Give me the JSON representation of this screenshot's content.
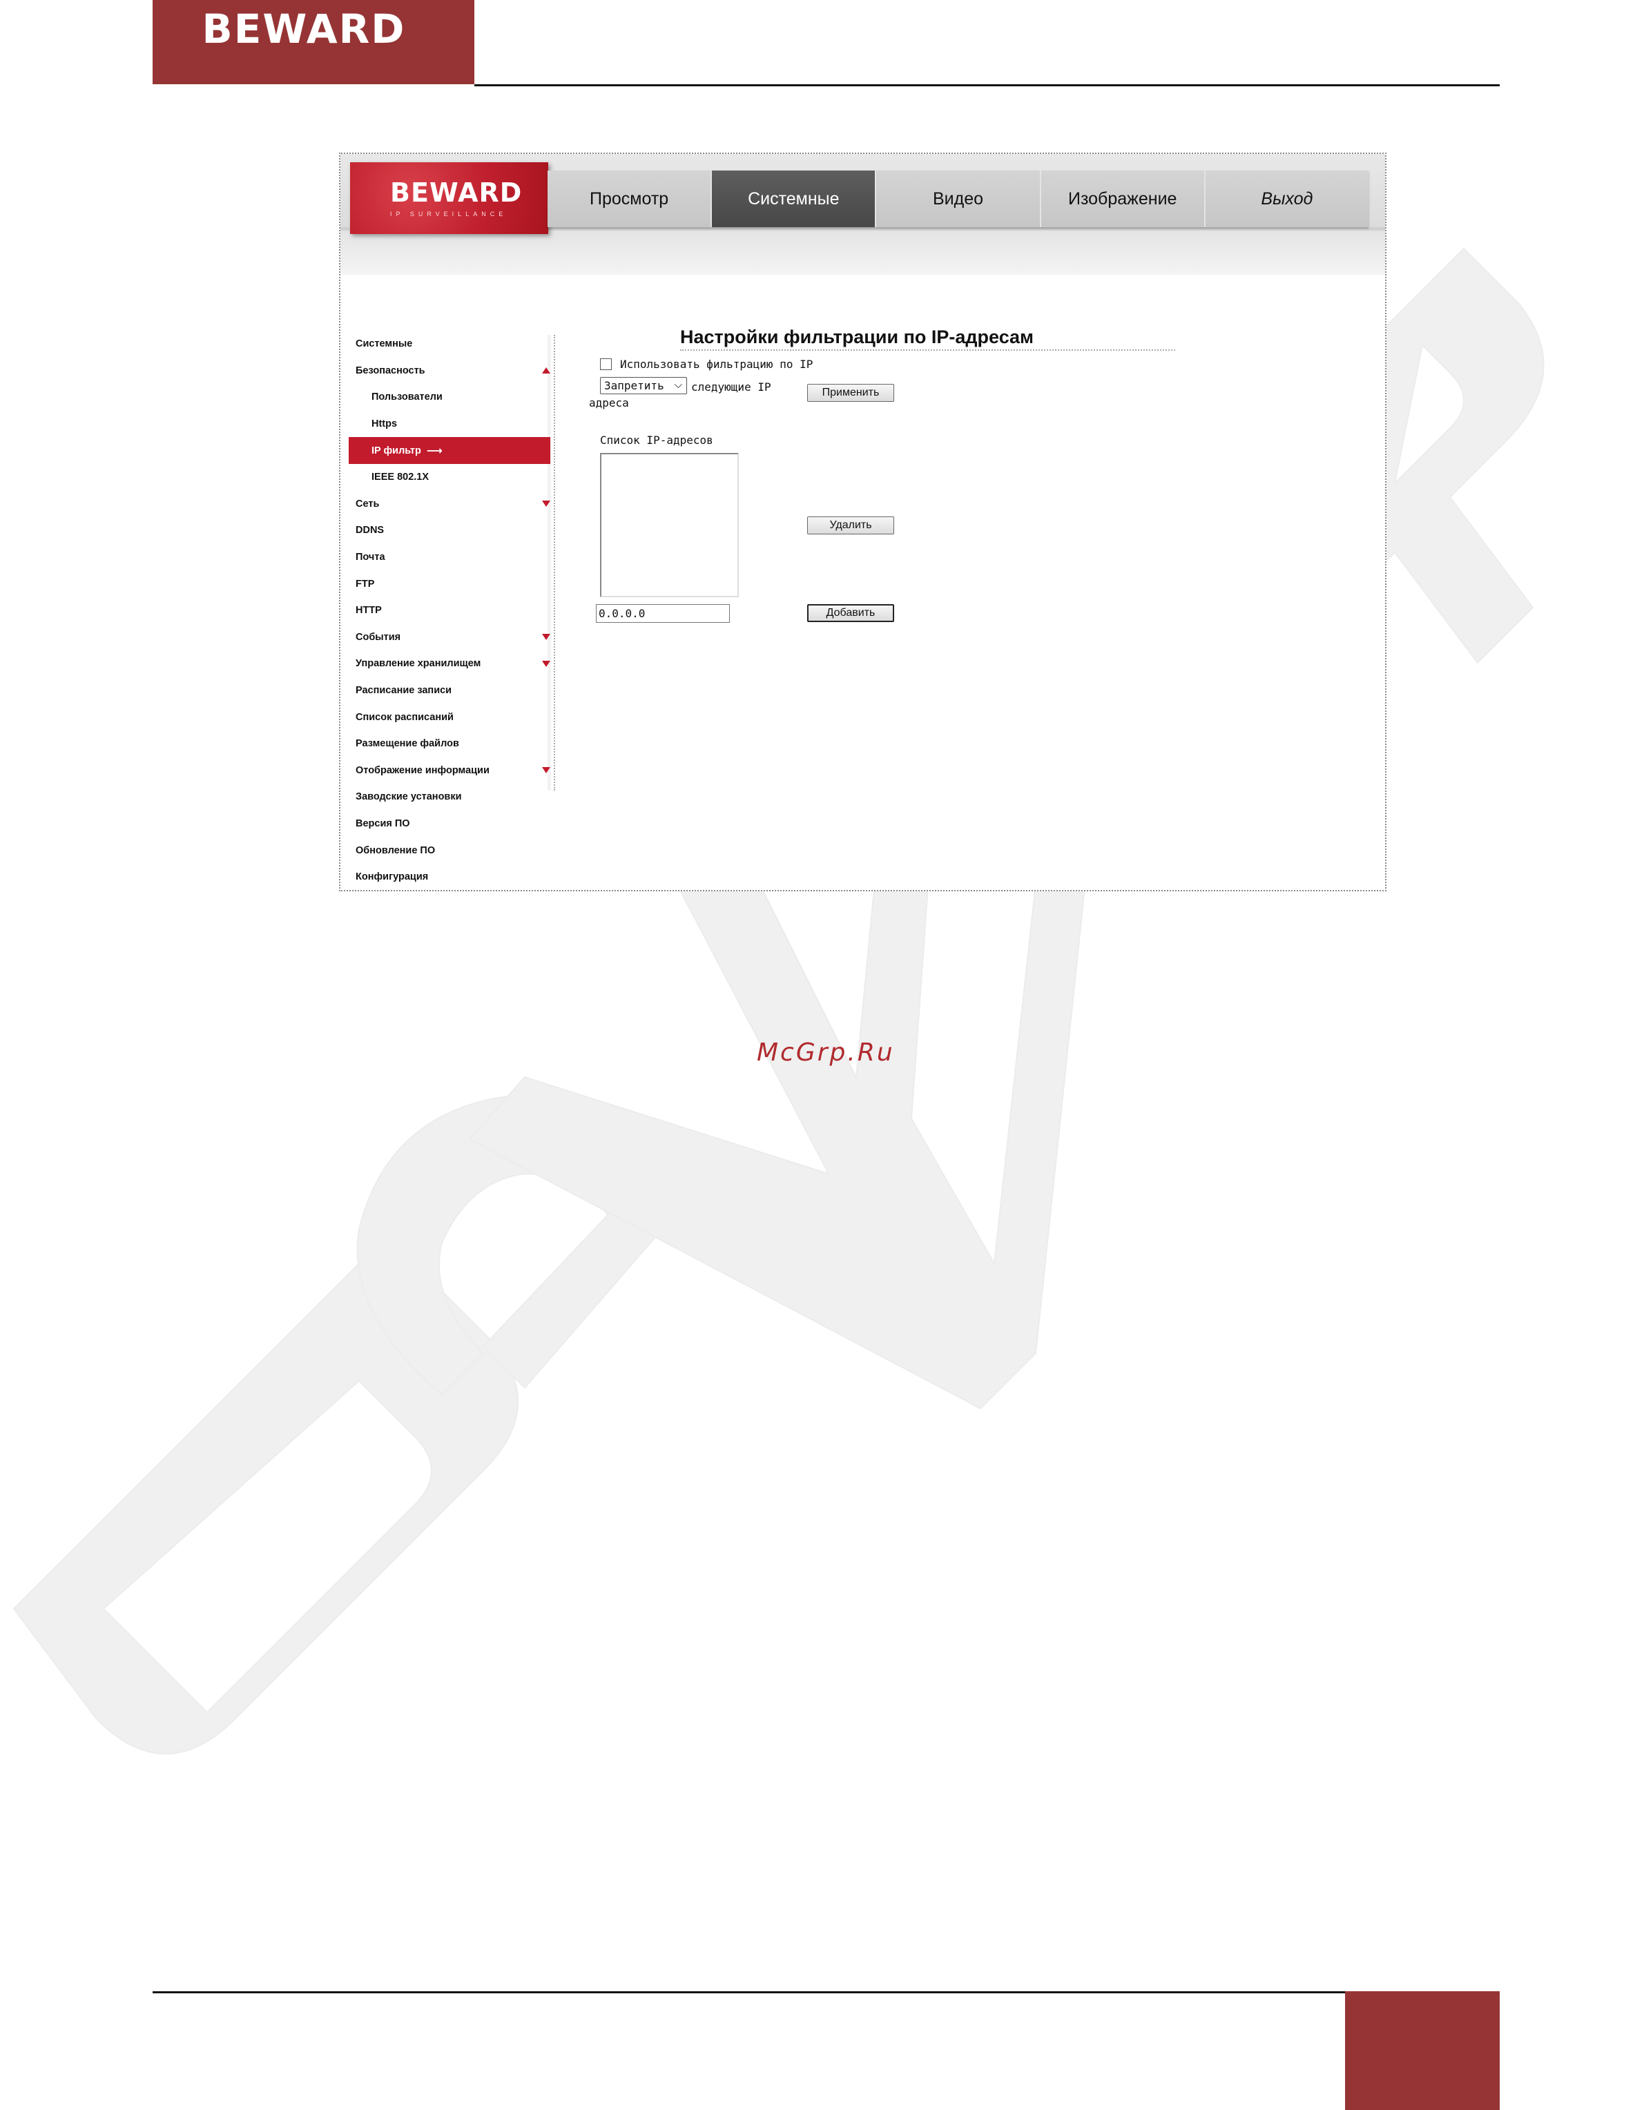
{
  "document": {
    "header_logo": "BEWARD",
    "footer_watermark": "McGrp.Ru"
  },
  "colors": {
    "brand": "#963435",
    "accent_red": "#c21b2c",
    "active_tab": "#4f4f4f"
  },
  "app": {
    "logo": "BEWARD",
    "logo_sub": "IP SURVEILLANCE"
  },
  "nav": {
    "tabs": [
      {
        "label": "Просмотр"
      },
      {
        "label": "Системные"
      },
      {
        "label": "Видео"
      },
      {
        "label": "Изображение"
      },
      {
        "label": "Выход"
      }
    ],
    "active": "Системные"
  },
  "sidebar": {
    "items": [
      {
        "label": "Системные"
      },
      {
        "label": "Безопасность"
      },
      {
        "label": "Пользователи"
      },
      {
        "label": "Https"
      },
      {
        "label": "IP фильтр"
      },
      {
        "label": "IEEE 802.1X"
      },
      {
        "label": "Сеть"
      },
      {
        "label": "DDNS"
      },
      {
        "label": "Почта"
      },
      {
        "label": "FTP"
      },
      {
        "label": "HTTP"
      },
      {
        "label": "События"
      },
      {
        "label": "Управление хранилищем"
      },
      {
        "label": "Расписание записи"
      },
      {
        "label": "Список расписаний"
      },
      {
        "label": "Размещение файлов"
      },
      {
        "label": "Отображение информации"
      },
      {
        "label": "Заводские установки"
      },
      {
        "label": "Версия ПО"
      },
      {
        "label": "Обновление ПО"
      },
      {
        "label": "Конфигурация"
      }
    ],
    "selected": "IP фильтр"
  },
  "content": {
    "title": "Настройки фильтрации по IP-адресам",
    "use_filter_label": "Использовать фильтрацию по IP",
    "use_filter_checked": false,
    "action_select_value": "Запретить",
    "following_text": "следующие IP",
    "addresses_text": "адреса",
    "apply_button": "Применить",
    "list_label": "Список IP-адресов",
    "ip_list": [],
    "delete_button": "Удалить",
    "ip_input_value": "0.0.0.0",
    "add_button": "Добавить"
  }
}
